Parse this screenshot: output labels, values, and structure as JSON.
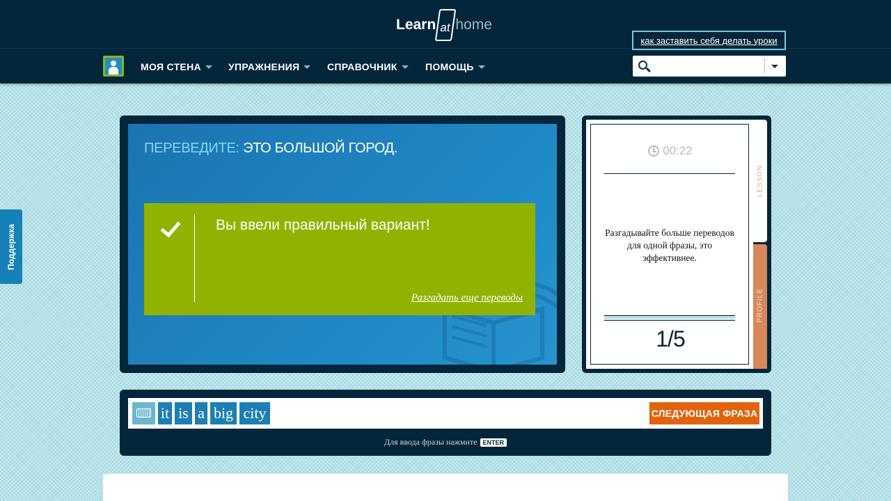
{
  "header": {
    "logo_learn": "Learn",
    "logo_at": "at",
    "logo_home": "home"
  },
  "nav": {
    "items": [
      {
        "label": "МОЯ СТЕНА"
      },
      {
        "label": "УПРАЖНЕНИЯ"
      },
      {
        "label": "СПРАВОЧНИК"
      },
      {
        "label": "ПОМОЩЬ"
      }
    ],
    "tip_link": "как заставить себя делать уроки",
    "search_placeholder": ""
  },
  "support": {
    "label": "Поддержка"
  },
  "exercise": {
    "prompt_label": "ПЕРЕВЕДИТЕ:",
    "prompt_text": "ЭТО БОЛЬШОЙ ГОРОД.",
    "result_message": "Вы ввели правильный вариант!",
    "more_link": "Разгадать еще переводы"
  },
  "side": {
    "timer": "00:22",
    "hint": "Разгадывайте больше переводов для одной фразы, это эффективнее.",
    "progress": "1/5",
    "tab_lesson": "LESSON",
    "tab_profile": "PROFILE"
  },
  "answer": {
    "words": [
      "it",
      "is",
      "a",
      "big",
      "city"
    ],
    "next_button": "СЛЕДУЮЩАЯ ФРАЗА",
    "enter_hint": "Для ввода фразы нажмите",
    "enter_key": "ENTER"
  },
  "colors": {
    "background": "#a9dbe3",
    "header": "#04263a",
    "exercise_blue": "#1f88c4",
    "success_green": "#8fb300",
    "next_orange": "#e2630f",
    "profile_tab": "#d9875a",
    "word_chip": "#1c7fb4"
  }
}
